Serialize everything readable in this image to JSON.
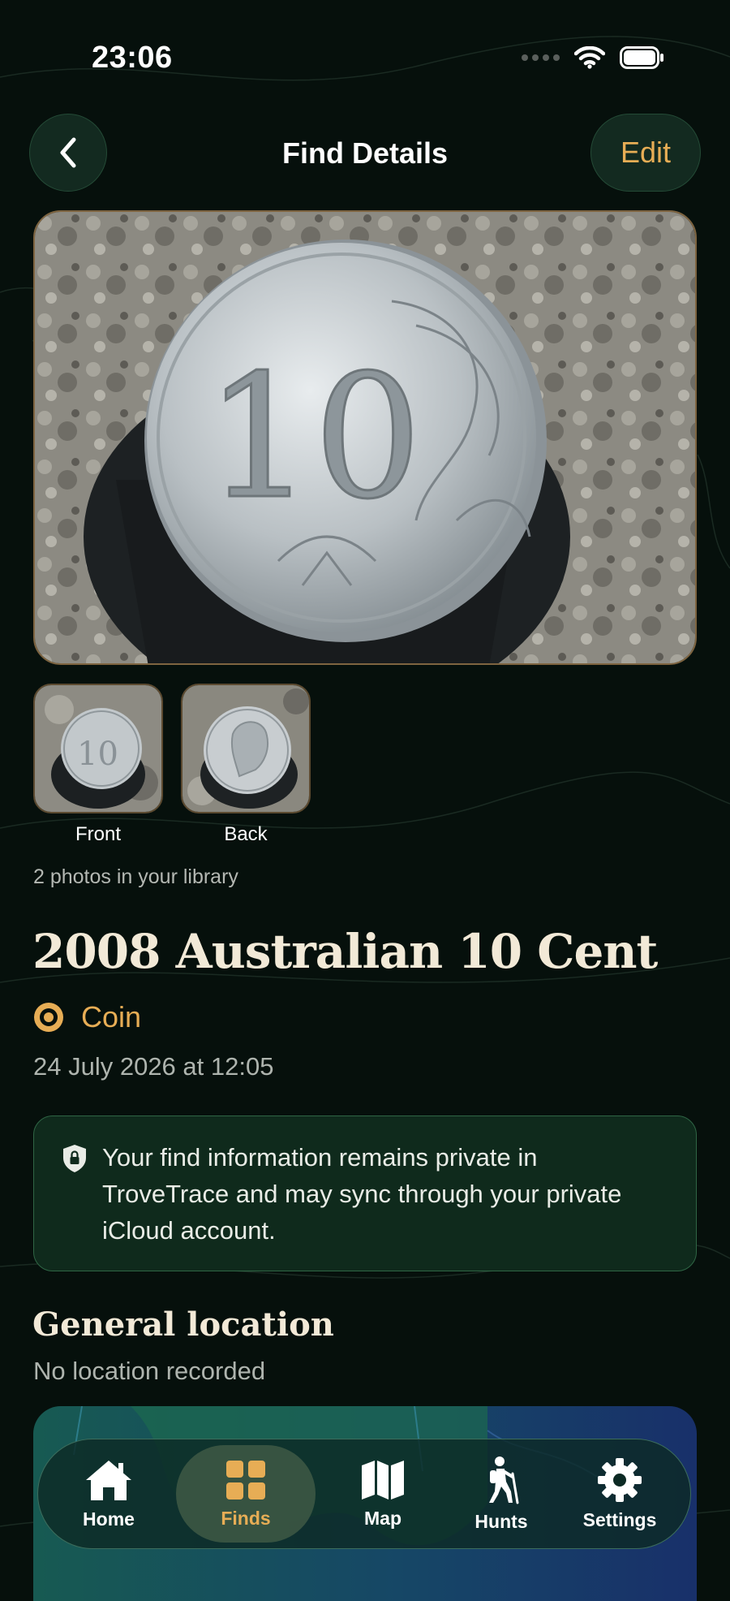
{
  "status_bar": {
    "time": "23:06"
  },
  "nav": {
    "title": "Find Details",
    "edit_label": "Edit",
    "back_icon": "chevron-left-icon"
  },
  "photos": {
    "main_alt": "2008 Australian 10 Cent",
    "thumbnails": [
      {
        "label": "Front"
      },
      {
        "label": "Back"
      }
    ],
    "count_text": "2 photos in your library"
  },
  "find": {
    "title": "2008 Australian 10 Cent",
    "category": "Coin",
    "date": "24 July 2026 at 12:05"
  },
  "privacy": {
    "icon": "shield-lock-icon",
    "text": "Your find information remains private in TroveTrace and may sync through your private iCloud account."
  },
  "location": {
    "section_title": "General location",
    "status": "No location recorded"
  },
  "tabbar": {
    "tabs": [
      {
        "label": "Home",
        "icon": "house-icon",
        "active": false
      },
      {
        "label": "Finds",
        "icon": "grid-icon",
        "active": true
      },
      {
        "label": "Map",
        "icon": "map-icon",
        "active": false
      },
      {
        "label": "Hunts",
        "icon": "hiker-icon",
        "active": false
      },
      {
        "label": "Settings",
        "icon": "gear-icon",
        "active": false
      }
    ]
  },
  "colors": {
    "accent": "#e7ad55",
    "background": "#06100c",
    "card_green": "#0f2a1c"
  }
}
